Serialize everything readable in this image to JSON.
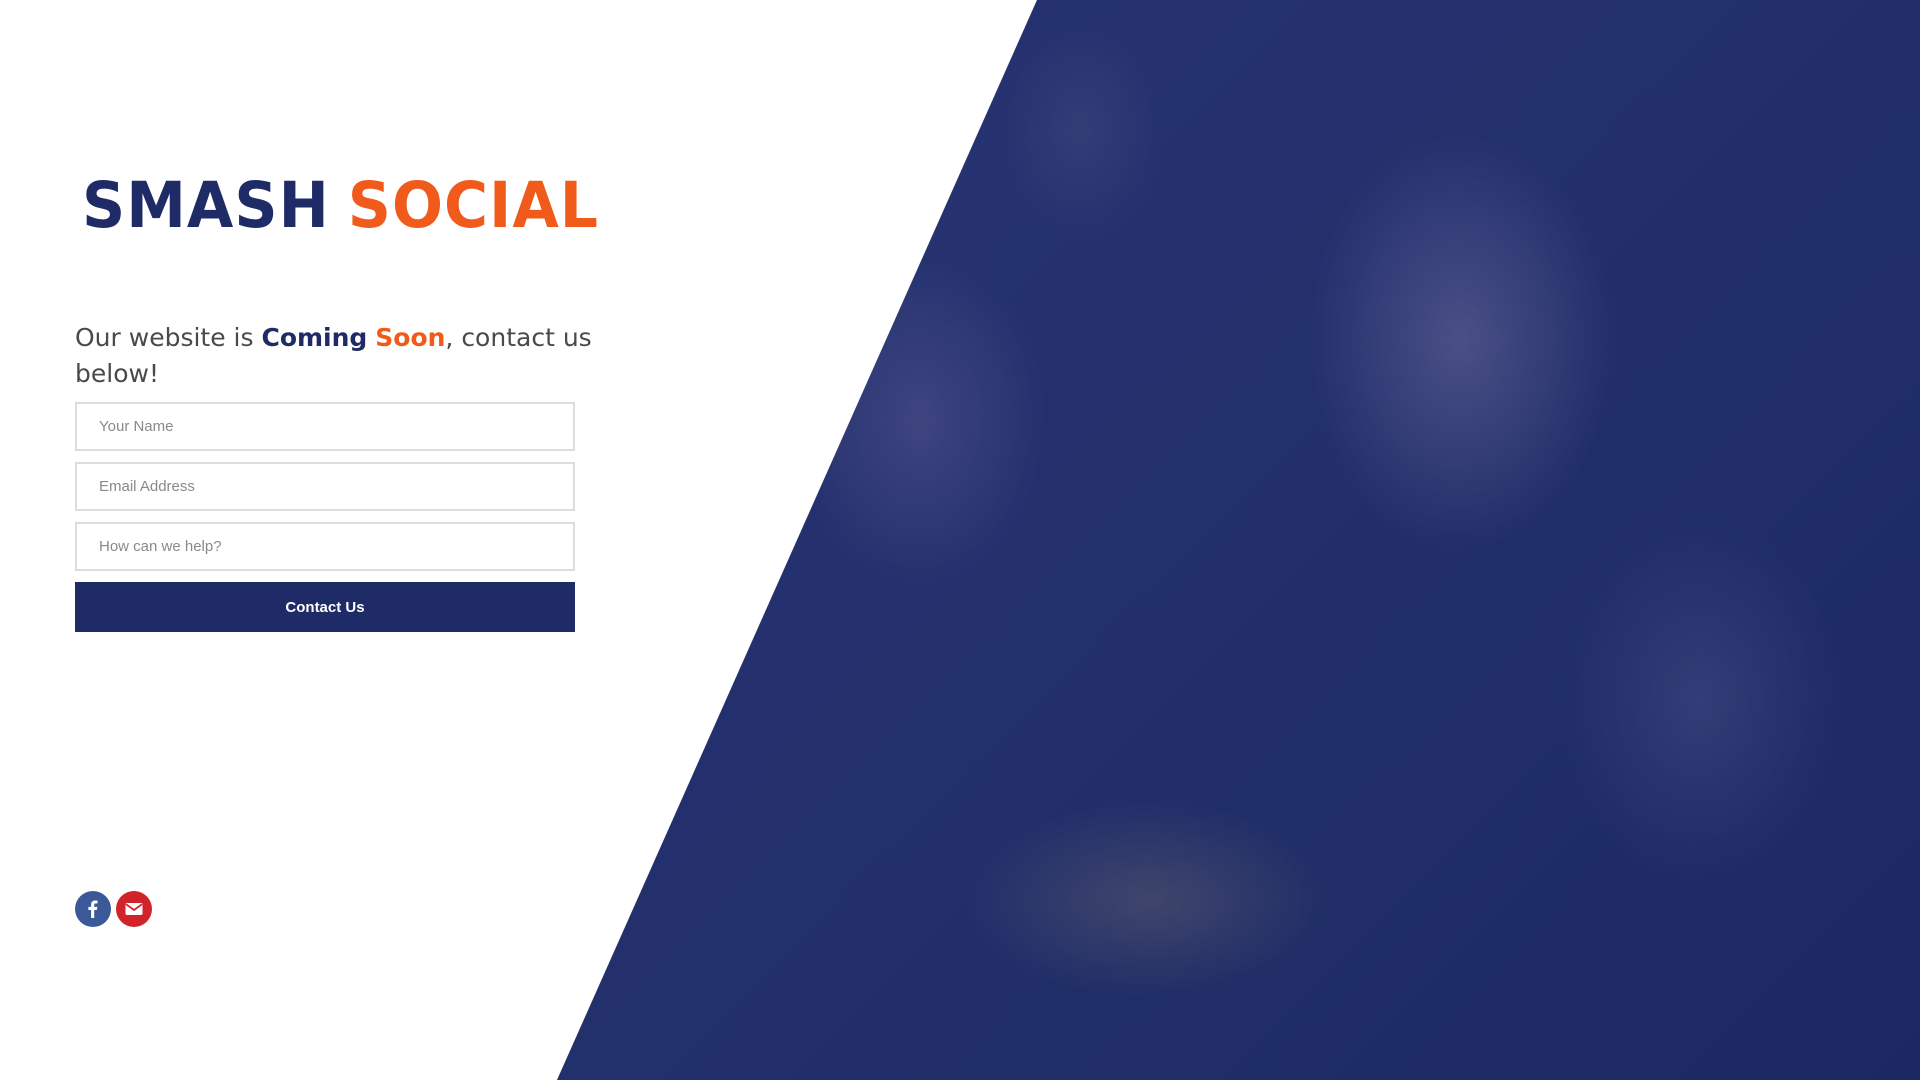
{
  "brand": {
    "logo_word_1": "SMASH",
    "logo_word_2": "SOCIAL"
  },
  "headline": {
    "prefix": "Our website is ",
    "emphasis_1": "Coming",
    "emphasis_2": "Soon",
    "suffix": ", contact us below!"
  },
  "form": {
    "name_placeholder": "Your Name",
    "email_placeholder": "Email Address",
    "message_placeholder": "How can we help?",
    "submit_label": "Contact Us"
  },
  "social": {
    "items": [
      {
        "icon": "facebook-icon",
        "color": "#3b5998"
      },
      {
        "icon": "email-icon",
        "color": "#d0232a"
      }
    ]
  },
  "colors": {
    "brand_navy": "#1f2b66",
    "brand_orange": "#f05a1a"
  }
}
